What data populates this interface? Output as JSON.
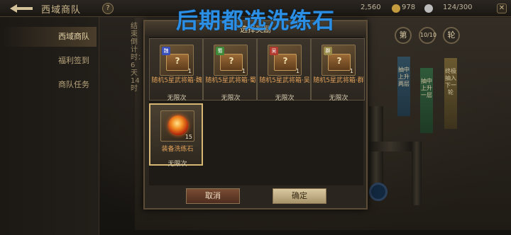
{
  "topbar": {
    "title": "西域商队",
    "help": "?",
    "res1": "978",
    "res2": "2,560",
    "res3": "124/300",
    "close": "✕"
  },
  "banner": "后期都选洗练石",
  "sidebar": {
    "items": [
      {
        "label": "西域商队",
        "active": true
      },
      {
        "label": "福利签到",
        "active": false
      },
      {
        "label": "商队任务",
        "active": false
      }
    ],
    "countdown": "结束倒计时：6天14时"
  },
  "right": {
    "btn_di": "第",
    "btn_count": "10/10",
    "btn_lun": "轮",
    "flag1": "抽中上升两层",
    "flag2": "抽中上升一层",
    "flag3": "终极 抽入下一轮"
  },
  "dialog": {
    "title": "选择奖励",
    "cards": [
      {
        "name": "随机5星武将箱·魏",
        "limit": "无限次",
        "faction": "魏",
        "faction_color": "#3a4fb8",
        "qty": "1"
      },
      {
        "name": "随机5星武将箱·蜀",
        "limit": "无限次",
        "faction": "蜀",
        "faction_color": "#3f8a3a",
        "qty": "1"
      },
      {
        "name": "随机5星武将箱·吴",
        "limit": "无限次",
        "faction": "吴",
        "faction_color": "#b23a2f",
        "qty": "1"
      },
      {
        "name": "随机5星武将箱·群",
        "limit": "无限次",
        "faction": "群",
        "faction_color": "#9a8a4a",
        "qty": "1"
      }
    ],
    "special": {
      "name": "装备洗练石",
      "limit": "无限次",
      "qty": "15"
    },
    "cancel": "取消",
    "confirm": "确定"
  }
}
